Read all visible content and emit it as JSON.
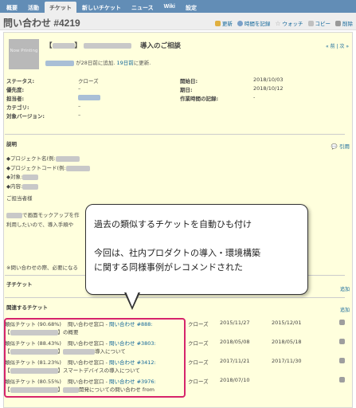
{
  "nav": {
    "tabs": [
      {
        "label": "概要"
      },
      {
        "label": "活動"
      },
      {
        "label": "チケット"
      },
      {
        "label": "新しいチケット"
      },
      {
        "label": "ニュース"
      },
      {
        "label": "Wiki"
      },
      {
        "label": "設定"
      }
    ]
  },
  "header": {
    "title": "問い合わせ #4219",
    "actions": {
      "update": "更新",
      "log_time": "時間を記録",
      "watch": "ウォッチ",
      "copy": "コピー",
      "delete": "削除"
    }
  },
  "issue": {
    "avatar_text": "Now Printing",
    "subject_prefix": "【",
    "subject_mid": "】",
    "subject_suffix": "導入のご相談",
    "author_text": "が28日前に追加. ",
    "author_updated": "19日前",
    "author_text2": "に更新.",
    "prev_next": "« 前 | 次 »",
    "attributes": [
      {
        "k": "ステータス:",
        "v": "クローズ",
        "k2": "開始日:",
        "v2": "2018/10/03"
      },
      {
        "k": "優先度:",
        "v": "–",
        "k2": "期日:",
        "v2": "2018/10/12"
      },
      {
        "k": "担当者:",
        "v": "",
        "k2": "作業時間の記録:",
        "v2": "-"
      },
      {
        "k": "カテゴリ:",
        "v": "–",
        "k2": "",
        "v2": ""
      },
      {
        "k": "対象バージョン:",
        "v": "–",
        "k2": "",
        "v2": ""
      }
    ]
  },
  "description": {
    "heading": "説明",
    "quote": "引用",
    "lines": [
      "◆プロジェクト名(例:",
      "◆プロジェクトコード(例:",
      "◆対象:",
      "◆内容:",
      "ご担当者様",
      "で画面モックアップを作",
      "利用したいので、導入手順や"
    ],
    "note": "※問い合わせの際、必要になる"
  },
  "subtasks": {
    "heading": "子チケット",
    "add": "追加"
  },
  "related": {
    "heading": "関連するチケット",
    "add": "追加",
    "rows": [
      {
        "l1a": "類似チケット (90.68%)",
        "l1b": "問い合わせ窓口 - ",
        "l1link": "問い合わせ #888:",
        "l2": "の概要",
        "status": "クローズ",
        "d1": "2015/11/27",
        "d2": "2015/12/01"
      },
      {
        "l1a": "類似チケット (88.43%)",
        "l1b": "問い合わせ窓口 - ",
        "l1link": "問い合わせ #3803:",
        "l2": "導入について",
        "status": "クローズ",
        "d1": "2018/05/08",
        "d2": "2018/05/18"
      },
      {
        "l1a": "類似チケット (81.23%)",
        "l1b": "問い合わせ窓口 - ",
        "l1link": "問い合わせ #3412:",
        "l2": "スマートデバイスの導入について",
        "status": "クローズ",
        "d1": "2017/11/21",
        "d2": "2017/11/30"
      },
      {
        "l1a": "類似チケット (80.55%)",
        "l1b": "問い合わせ窓口 - ",
        "l1link": "問い合わせ #3976:",
        "l2": "開発についての問い合わせ from",
        "status": "クローズ",
        "d1": "2018/07/10",
        "d2": ""
      }
    ]
  },
  "callout": {
    "line1": "過去の類似するチケットを自動ひも付け",
    "line2": "今回は、社内プロダクトの導入・環境構築",
    "line3": "に関する同様事例がレコメンドされた"
  },
  "colors": {
    "nav_bg": "#628db6",
    "panel_bg": "#ffffdd",
    "highlight": "#d6246b",
    "link": "#116699"
  }
}
